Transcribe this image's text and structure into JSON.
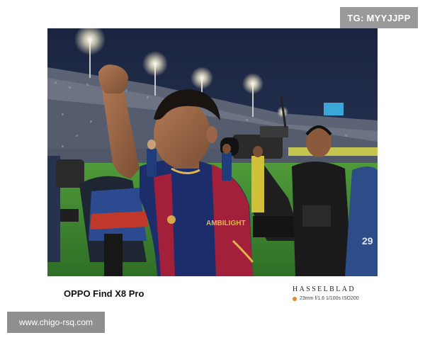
{
  "tag_badge": "TG: MYYJJPP",
  "caption": {
    "device": "OPPO Find X8 Pro",
    "brand": "HASSELBLAD",
    "exif": "23mm f/1.6 1/100s ISO200",
    "exif_dot_color": "#e08a2a"
  },
  "photo": {
    "jersey_text": "AMBILIGHT",
    "bib_text": "29"
  },
  "watermark": "www.chigo-rsq.com"
}
